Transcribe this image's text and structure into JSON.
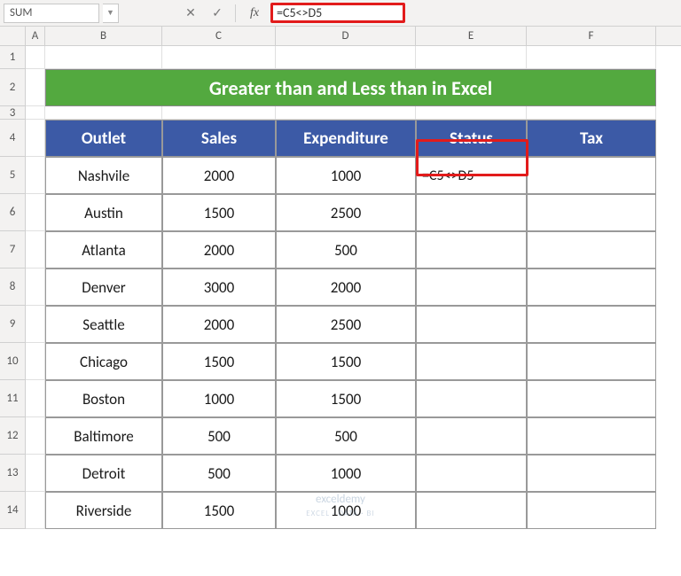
{
  "namebox": "SUM",
  "formula_bar": "=C5<>D5",
  "title": "Greater than and Less than in Excel",
  "columns": [
    "A",
    "B",
    "C",
    "D",
    "E",
    "F"
  ],
  "row_numbers": [
    "1",
    "2",
    "3",
    "4",
    "5",
    "6",
    "7",
    "8",
    "9",
    "10",
    "11",
    "12",
    "13",
    "14"
  ],
  "headers": {
    "b": "Outlet",
    "c": "Sales",
    "d": "Expenditure",
    "e": "Status",
    "f": "Tax"
  },
  "active_cell_text": "=C5<>D5",
  "rows": [
    {
      "b": "Nashvile",
      "c": "2000",
      "d": "1000"
    },
    {
      "b": "Austin",
      "c": "1500",
      "d": "2500"
    },
    {
      "b": "Atlanta",
      "c": "2000",
      "d": "500"
    },
    {
      "b": "Denver",
      "c": "3000",
      "d": "2000"
    },
    {
      "b": "Seattle",
      "c": "2000",
      "d": "2500"
    },
    {
      "b": "Chicago",
      "c": "1500",
      "d": "1500"
    },
    {
      "b": "Boston",
      "c": "1000",
      "d": "1500"
    },
    {
      "b": "Baltimore",
      "c": "500",
      "d": "500"
    },
    {
      "b": "Detroit",
      "c": "500",
      "d": "1000"
    },
    {
      "b": "Riverside",
      "c": "1500",
      "d": "1000"
    }
  ],
  "watermark1": "exceldemy",
  "watermark2": "EXCEL · DATA · BI",
  "chart_data": {
    "type": "table",
    "title": "Greater than and Less than in Excel",
    "columns": [
      "Outlet",
      "Sales",
      "Expenditure",
      "Status",
      "Tax"
    ],
    "rows": [
      [
        "Nashvile",
        2000,
        1000,
        "=C5<>D5",
        null
      ],
      [
        "Austin",
        1500,
        2500,
        null,
        null
      ],
      [
        "Atlanta",
        2000,
        500,
        null,
        null
      ],
      [
        "Denver",
        3000,
        2000,
        null,
        null
      ],
      [
        "Seattle",
        2000,
        2500,
        null,
        null
      ],
      [
        "Chicago",
        1500,
        1500,
        null,
        null
      ],
      [
        "Boston",
        1000,
        1500,
        null,
        null
      ],
      [
        "Baltimore",
        500,
        500,
        null,
        null
      ],
      [
        "Detroit",
        500,
        1000,
        null,
        null
      ],
      [
        "Riverside",
        1500,
        1000,
        null,
        null
      ]
    ]
  }
}
